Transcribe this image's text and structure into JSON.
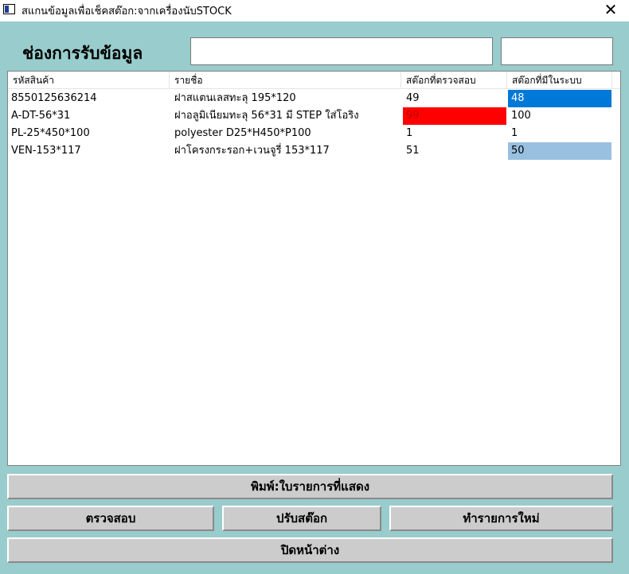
{
  "window": {
    "title": "สแกนข้อมูลเพื่อเช็คสต๊อก:จากเครื่องนับSTOCK",
    "close_glyph": "✕"
  },
  "form": {
    "heading": "ช่องการรับข้อมูล",
    "input1_value": "",
    "input2_value": ""
  },
  "table": {
    "columns": [
      "รหัสสินค้า",
      "รายชื่อ",
      "สต๊อกที่ตรวจสอบ",
      "สต๊อกที่มีในระบบ"
    ],
    "rows": [
      {
        "code": "8550125636214",
        "name": "ฝาสแตนเลสทะลุ 195*120",
        "checked": "49",
        "system": "48"
      },
      {
        "code": "A-DT-56*31",
        "name": "ฝาอลูมิเนียมทะลุ 56*31 มี STEP ใส่โอริง",
        "checked": "99",
        "system": "100"
      },
      {
        "code": "PL-25*450*100",
        "name": "polyester D25*H450*P100",
        "checked": "1",
        "system": "1"
      },
      {
        "code": "VEN-153*117",
        "name": "ฝาโครงกระรอก+เวนจูรี่ 153*117",
        "checked": "51",
        "system": "50"
      }
    ]
  },
  "buttons": {
    "print": "พิมพ์:ใบรายการที่แสดง",
    "check": "ตรวจสอบ",
    "adjust": "ปรับสต๊อก",
    "new": "ทำรายการใหม่",
    "close": "ปิดหน้าต่าง"
  },
  "colors": {
    "background": "#99cccc",
    "mismatch_red": "#ff0000",
    "selected_blue": "#0078d7",
    "highlight_lightblue": "#99c0e0"
  }
}
